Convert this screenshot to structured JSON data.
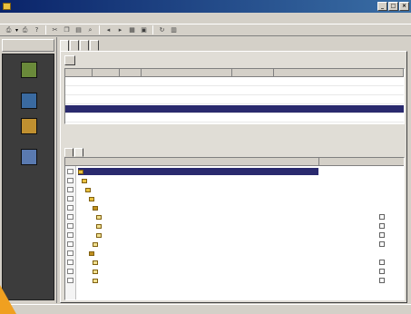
{
  "window": {
    "title": "",
    "controls": [
      "_",
      "□",
      "×"
    ]
  },
  "menu": [
    "",
    "",
    "",
    "",
    "",
    ""
  ],
  "toolbar": {
    "export_label": "",
    "icons": [
      "print-icon",
      "help-icon",
      "cut-icon",
      "copy-icon",
      "paste-icon",
      "find-icon",
      "back-icon",
      "forward-icon",
      "grid-icon",
      "save-icon",
      "refresh-icon",
      "view-icon"
    ]
  },
  "left_panel": {
    "header": [
      "",
      ""
    ],
    "items": [
      {
        "label": [
          "",
          ""
        ],
        "icon": "profile-icon",
        "color": "#6a8a3a"
      },
      {
        "label": [
          ""
        ],
        "icon": "document-icon",
        "color": "#3a6aa0"
      },
      {
        "label": [
          "",
          ""
        ],
        "icon": "training-icon",
        "color": "#c09030"
      },
      {
        "label": [
          "",
          ""
        ],
        "icon": "meetings-icon",
        "color": "#5a7ab0"
      }
    ]
  },
  "main_tabs": [
    "",
    "",
    "",
    ""
  ],
  "subtab": "",
  "grid": {
    "columns": [
      "",
      "",
      "",
      "",
      "",
      ""
    ],
    "rows": [
      [
        "",
        "",
        "",
        "",
        "",
        ""
      ],
      [
        "",
        "",
        "",
        "",
        "",
        ""
      ],
      [
        "",
        "",
        "",
        "",
        "",
        ""
      ],
      [
        "",
        "",
        "",
        "",
        "",
        ""
      ],
      [
        "",
        "",
        "",
        "",
        "",
        ""
      ]
    ],
    "selected_row": 3
  },
  "lower_tabs": [
    "",
    ""
  ],
  "tree": {
    "columns": [
      "",
      ""
    ],
    "rows": [
      {
        "text": "",
        "right": ""
      },
      {
        "text": "",
        "right": ""
      },
      {
        "text": "",
        "right": ""
      },
      {
        "text": "",
        "right": ""
      },
      {
        "text": "",
        "right": ""
      },
      {
        "text": "",
        "right": ""
      },
      {
        "text": "",
        "right": ""
      },
      {
        "text": "",
        "right": ""
      },
      {
        "text": "",
        "right": ""
      },
      {
        "text": "",
        "right": ""
      },
      {
        "text": "",
        "right": ""
      },
      {
        "text": "",
        "right": ""
      },
      {
        "text": "",
        "right": ""
      }
    ]
  },
  "status": "",
  "colors": {
    "titlebar": "#0a246a",
    "selection": "#2a2a6e",
    "background": "#c86a10"
  }
}
